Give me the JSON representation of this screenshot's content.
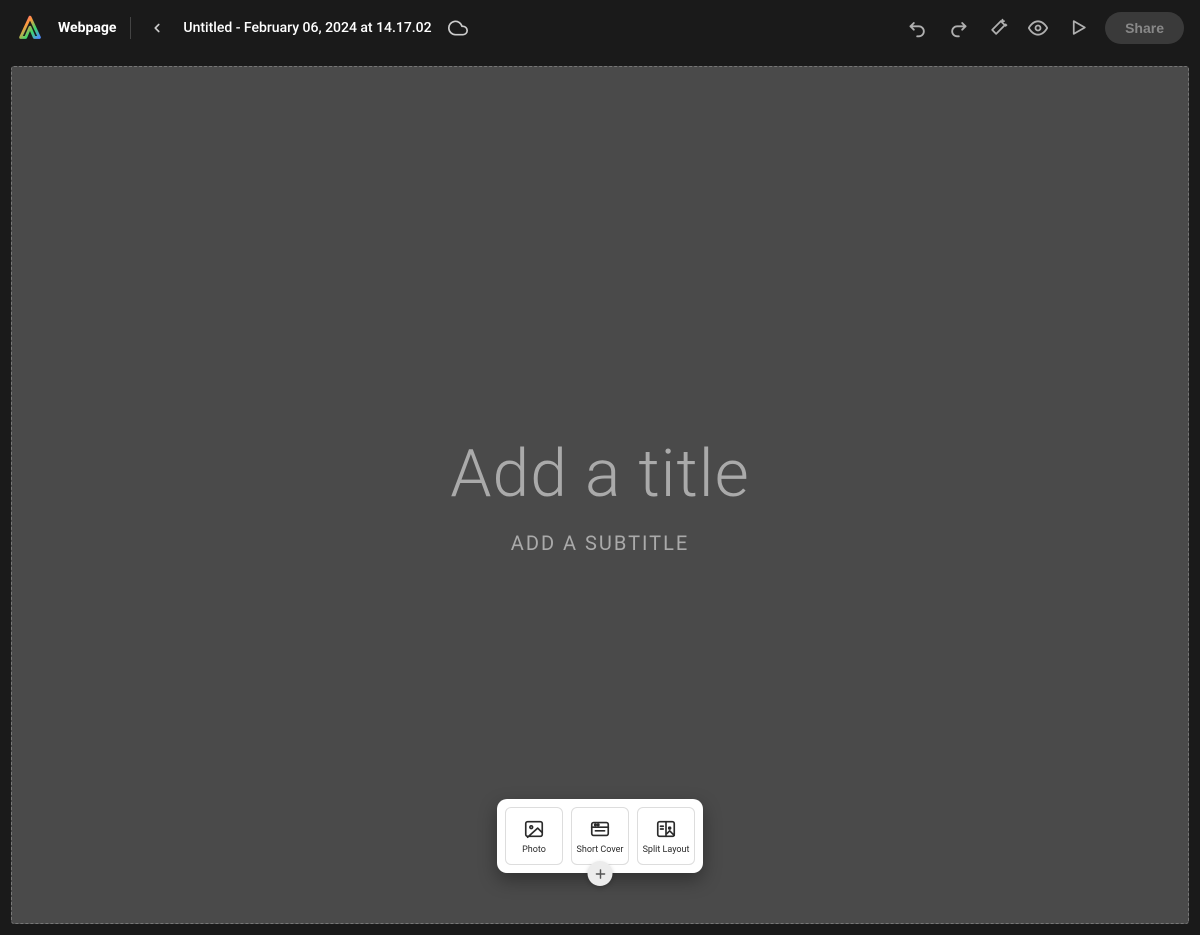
{
  "header": {
    "app_type": "Webpage",
    "document_title": "Untitled - February 06, 2024 at 14.17.02",
    "share_label": "Share"
  },
  "canvas": {
    "title_placeholder": "Add a title",
    "subtitle_placeholder": "ADD A SUBTITLE"
  },
  "contextual_panel": {
    "options": [
      {
        "label": "Photo"
      },
      {
        "label": "Short Cover"
      },
      {
        "label": "Split Layout"
      }
    ]
  }
}
